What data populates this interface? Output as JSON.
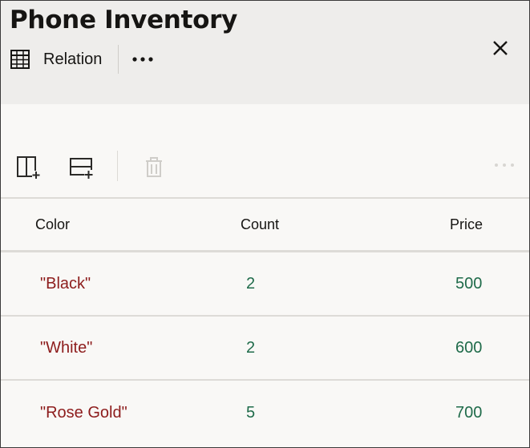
{
  "header": {
    "title": "Phone Inventory",
    "type_label": "Relation",
    "type_icon": "table-grid-icon",
    "more_icon": "more-horizontal-icon",
    "close_icon": "close-icon"
  },
  "toolbar": {
    "add_column_icon": "add-column-icon",
    "add_row_icon": "add-row-icon",
    "delete_icon": "trash-icon",
    "more_icon": "more-horizontal-icon",
    "delete_enabled": false,
    "more_enabled": false
  },
  "table": {
    "columns": [
      "Color",
      "Count",
      "Price"
    ],
    "rows": [
      [
        "\"Black\"",
        "2",
        "500"
      ],
      [
        "\"White\"",
        "2",
        "600"
      ],
      [
        "\"Rose Gold\"",
        "5",
        "700"
      ]
    ]
  },
  "colors": {
    "string_value": "#8d1c1c",
    "number_value": "#1f6b4a",
    "header_bg": "#eeedeb",
    "body_bg": "#f9f8f6"
  }
}
